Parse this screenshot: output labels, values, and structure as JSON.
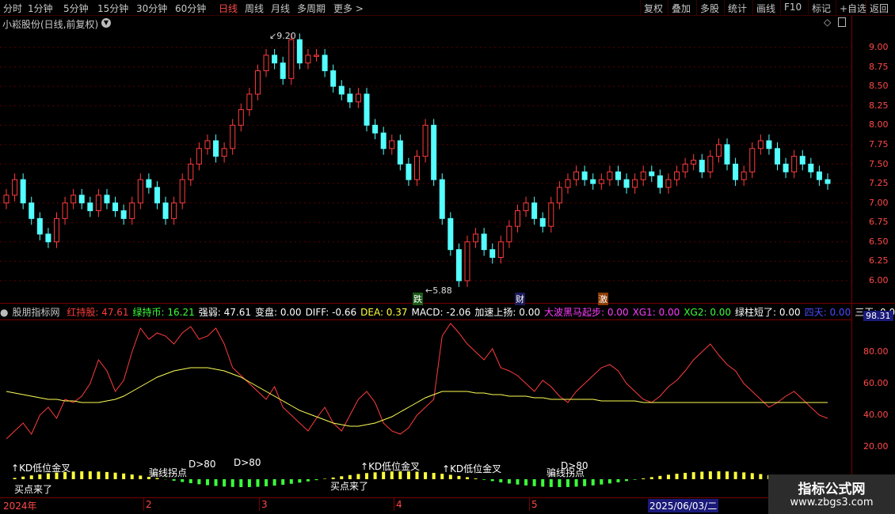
{
  "toolbar": {
    "periods": [
      "分时",
      "1分钟",
      "5分钟",
      "15分钟",
      "30分钟",
      "60分钟",
      "日线",
      "周线",
      "月线",
      "多周期",
      "更多 >"
    ],
    "active_period": "日线",
    "right_buttons": [
      "复权",
      "叠加",
      "多股",
      "统计",
      "画线",
      "F10",
      "标记",
      "+自选",
      "返回"
    ]
  },
  "stock": {
    "title": "小崧股份(日线,前复权)"
  },
  "price_axis": {
    "labels": [
      "9.00",
      "8.75",
      "8.50",
      "8.25",
      "8.00",
      "7.75",
      "7.50",
      "7.25",
      "7.00",
      "6.75",
      "6.50",
      "6.25",
      "6.00"
    ]
  },
  "annotations": {
    "high": "9.20",
    "low": "5.88",
    "marker_fall": "跌",
    "marker_cai": "财",
    "marker_ji": "激"
  },
  "indicator": {
    "name": "股朋指标网",
    "items": [
      {
        "label": "红持股:",
        "value": "47.61",
        "color": "#ff3c3c"
      },
      {
        "label": "绿持币:",
        "value": "16.21",
        "color": "#3cff3c"
      },
      {
        "label": "强弱:",
        "value": "47.61",
        "color": "#ffffff"
      },
      {
        "label": "变盘:",
        "value": "0.00",
        "color": "#ffffff"
      },
      {
        "label": "DIFF:",
        "value": "-0.66",
        "color": "#ffffff"
      },
      {
        "label": "DEA:",
        "value": "0.37",
        "color": "#ffff3c"
      },
      {
        "label": "MACD:",
        "value": "-2.06",
        "color": "#ffffff"
      },
      {
        "label": "加速上扬:",
        "value": "0.00",
        "color": "#ffffff"
      },
      {
        "label": "大波黑马起步:",
        "value": "0.00",
        "color": "#ff3cff"
      },
      {
        "label": "XG1:",
        "value": "0.00",
        "color": "#ff3cff"
      },
      {
        "label": "XG2:",
        "value": "0.00",
        "color": "#3cff3c"
      },
      {
        "label": "绿柱短了:",
        "value": "0.00",
        "color": "#ffffff"
      },
      {
        "label": "四天:",
        "value": "0.00",
        "color": "#4a4aff"
      },
      {
        "label": "三天:",
        "value": "0.00",
        "color": "#ffffff"
      }
    ],
    "axis_current": "98.31",
    "axis_labels": [
      "80.00",
      "60.00",
      "40.00",
      "20.00"
    ],
    "signals": {
      "kd_golden": "KD低位金叉",
      "d80": "D>80",
      "wash": "骗线拐点",
      "buy": "买点来了"
    }
  },
  "dates": {
    "year": "2024年",
    "months": [
      "2",
      "3",
      "4",
      "5"
    ],
    "highlight": "2025/06/03/二"
  },
  "watermark": {
    "title": "指标公式网",
    "url": "www.zbgs3.com"
  },
  "colors": {
    "up": "#ff3c3c",
    "down": "#54ffff",
    "ma": "#ffff55",
    "grid": "#7a0000"
  }
}
